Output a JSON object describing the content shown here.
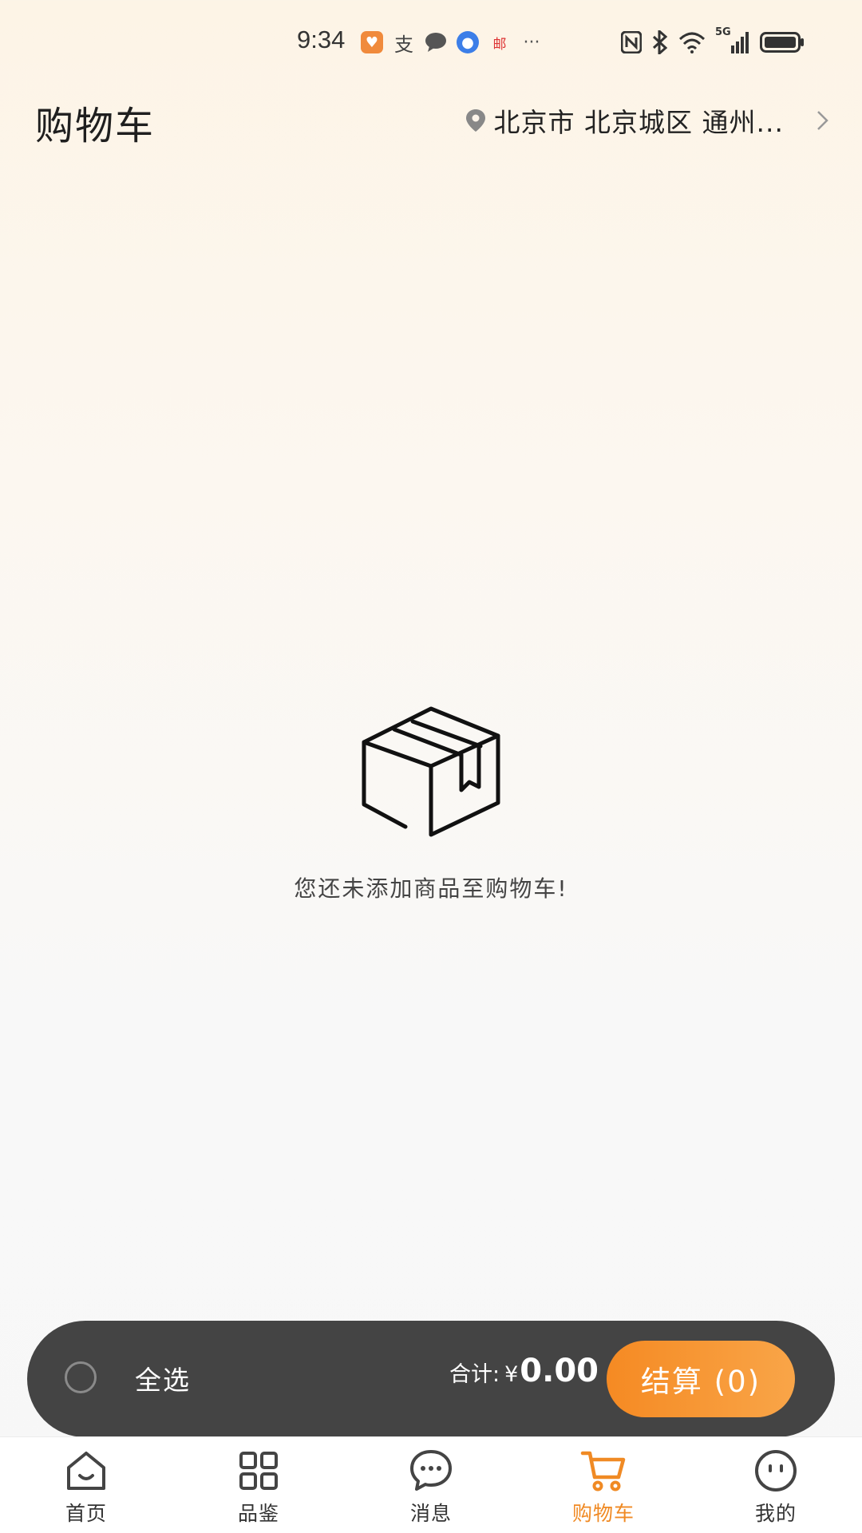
{
  "status_bar": {
    "time": "9:34",
    "network": "5G"
  },
  "header": {
    "title": "购物车",
    "location": "北京市 北京城区 通州..."
  },
  "empty_state": {
    "message": "您还未添加商品至购物车!"
  },
  "checkout_bar": {
    "select_all_label": "全选",
    "total_label": "合计:",
    "currency": "¥",
    "total_amount": "0.00",
    "checkout_label": "结算 (0)"
  },
  "bottom_nav": {
    "items": [
      {
        "label": "首页",
        "icon": "home-icon",
        "active": false
      },
      {
        "label": "品鉴",
        "icon": "grid-icon",
        "active": false
      },
      {
        "label": "消息",
        "icon": "chat-icon",
        "active": false
      },
      {
        "label": "购物车",
        "icon": "cart-icon",
        "active": true
      },
      {
        "label": "我的",
        "icon": "profile-icon",
        "active": false
      }
    ]
  },
  "colors": {
    "accent": "#f08a24",
    "checkout_bar_bg": "#444444",
    "checkout_button_start": "#f58a23",
    "checkout_button_end": "#f9a548"
  }
}
